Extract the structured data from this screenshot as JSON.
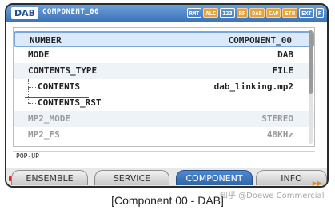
{
  "header": {
    "app_badge": "DAB",
    "title": "COMPONENT_00",
    "status_badges": [
      {
        "label": "RMT",
        "state": "off"
      },
      {
        "label": "ALC",
        "state": "on"
      },
      {
        "label": "123",
        "state": "off"
      },
      {
        "label": "RF",
        "state": "on"
      },
      {
        "label": "DAB",
        "state": "on"
      },
      {
        "label": "CAP",
        "state": "on"
      },
      {
        "label": "ETH",
        "state": "on"
      },
      {
        "label": "EXT",
        "state": "off"
      },
      {
        "label": "F",
        "state": "off"
      }
    ]
  },
  "rows": [
    {
      "label": "NUMBER",
      "value": "COMPONENT_00",
      "state": "selected"
    },
    {
      "label": "MODE",
      "value": "DAB",
      "state": "normal"
    },
    {
      "label": "CONTENTS_TYPE",
      "value": "FILE",
      "state": "normal"
    },
    {
      "label": "CONTENTS",
      "value": "dab_linking.mp2",
      "state": "normal"
    },
    {
      "label": "CONTENTS_RST",
      "value": "",
      "state": "normal"
    },
    {
      "label": "MP2_MODE",
      "value": "STEREO",
      "state": "disabled"
    },
    {
      "label": "MP2_FS",
      "value": "48KHz",
      "state": "disabled"
    }
  ],
  "popup": {
    "text": "POP-UP"
  },
  "tabs": [
    "ENSEMBLE",
    "SERVICE",
    "COMPONENT",
    "INFO"
  ],
  "active_tab": "COMPONENT",
  "caption": "[Component 00 - DAB]",
  "watermark": "知乎 @Doewe Commercial",
  "colors": {
    "accent": "#3e74b8",
    "highlight": "#e6a23c",
    "underline": "#cc00cc"
  }
}
